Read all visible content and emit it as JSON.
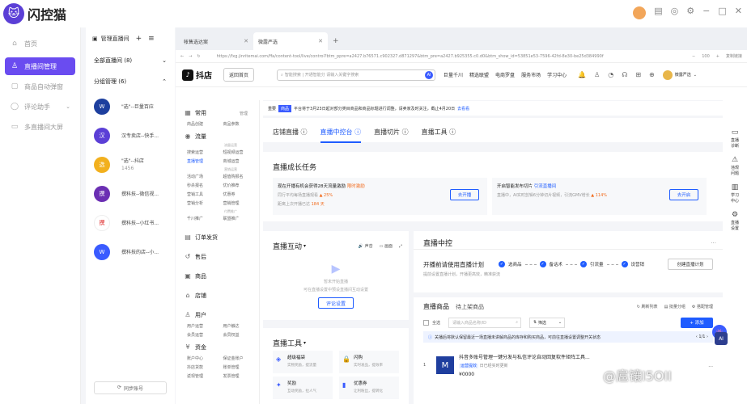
{
  "app": {
    "name": "闪控猫"
  },
  "nav": [
    {
      "label": "首页",
      "icon": "home-icon"
    },
    {
      "label": "直播间管理",
      "icon": "user-icon",
      "active": true
    },
    {
      "label": "商品自动弹窗",
      "icon": "popup-icon"
    },
    {
      "label": "评论助手",
      "icon": "comment-icon",
      "chevron": "⌄"
    },
    {
      "label": "多直播间大屏",
      "icon": "screen-icon"
    }
  ],
  "rooms": {
    "manage_label": "管理直播间",
    "all_rooms": "全部直播间 (8)",
    "grouped": "分组管理 (6)",
    "items": [
      {
        "name": "\"选\"--巨量百应",
        "sub": "",
        "color": "#1d3f9e",
        "glyph": "W"
      },
      {
        "name": "汉专卖店--快手...",
        "sub": "",
        "color": "#5b3fd6",
        "glyph": "汉"
      },
      {
        "name": "\"选\"--抖店",
        "sub": "1456",
        "color": "#f2b01e",
        "glyph": "选"
      },
      {
        "name": "撰科技--微信视...",
        "sub": "",
        "color": "#6b2fb3",
        "glyph": "撰"
      },
      {
        "name": "撰科技--小红书...",
        "sub": "",
        "color": "#ffffff",
        "glyph": "撰"
      },
      {
        "name": "撰科技的店--小...",
        "sub": "",
        "color": "#3a5bff",
        "glyph": "W"
      }
    ],
    "sync_button": "同步账号"
  },
  "browser": {
    "tabs": [
      {
        "label": "帐售选达案"
      },
      {
        "label": "微露严选"
      }
    ],
    "url": "https://fxg.jinritemai.com/ffa/content-tool/live/control?btm_ppre=a2427.b76571.c902327.d871297&btm_pre=a2427.b925355.c0.d0&btm_show_id=53851e53-7596-42fd-8e30-be25d384990f",
    "zoom": "100",
    "zoom_suffix": "+",
    "print_label": "复制链接"
  },
  "douyin": {
    "logo": "抖店",
    "back_home": "返回首页",
    "search_placeholder": "智能搜索 | 开通智能分 请输入关键字搜索",
    "ai_badge": "AI",
    "links": [
      "巨量千川",
      "精选联盟",
      "电商罗盘",
      "服务市场",
      "学习中心"
    ],
    "shop_name": "微露严选"
  },
  "side": {
    "groups": [
      {
        "icon": "grid-icon",
        "label": "常用",
        "right": "管理",
        "caption": "",
        "items": [
          "商品创建",
          "商品参数"
        ],
        "active": -1
      },
      {
        "icon": "flame-icon",
        "label": "流量",
        "right": "",
        "caption": "流量运营",
        "items": [
          "搜索运营",
          "短视频运营",
          "直播管理",
          "商城运营"
        ],
        "active": 2
      },
      {
        "icon": "",
        "label": "",
        "right": "",
        "caption": "营销运营",
        "items": [
          "活动广场",
          "超值购报名",
          "秒杀报名",
          "优价推荐",
          "营销工具",
          "优惠券",
          "营销分析",
          "营销管理"
        ],
        "active": -1
      },
      {
        "icon": "",
        "label": "",
        "right": "",
        "caption": "付费推广",
        "items": [
          "千川推广",
          "联盟推广"
        ],
        "active": -1
      },
      {
        "icon": "order-icon",
        "label": "订单发货",
        "right": "",
        "caption": "",
        "items": [],
        "active": -1
      },
      {
        "icon": "after-sale-icon",
        "label": "售后",
        "right": "",
        "caption": "",
        "items": [],
        "active": -1
      },
      {
        "icon": "box-icon",
        "label": "商品",
        "right": "",
        "caption": "",
        "items": [],
        "active": -1
      },
      {
        "icon": "store-icon",
        "label": "店铺",
        "right": "",
        "caption": "",
        "items": [],
        "active": -1
      },
      {
        "icon": "users-icon",
        "label": "用户",
        "right": "",
        "caption": "",
        "items": [
          "用户运营",
          "用户触达",
          "会员运营",
          "会员权益"
        ],
        "active": -1
      },
      {
        "icon": "money-icon",
        "label": "资金",
        "right": "",
        "caption": "",
        "items": [
          "账户中心",
          "保证金账户",
          "抖店货款",
          "账单管理",
          "返现管理",
          "发票管理"
        ],
        "active": -1
      }
    ]
  },
  "notice": {
    "tag_label": "重要",
    "tag": "商品",
    "text": "平台将于3月23日起对部分类目商品和商品标题进行调整，请卖家及时关注，截止4月20日",
    "link": "去看看"
  },
  "subtabs": [
    "店铺直播 ⓘ",
    "直播中控台 ⓘ",
    "直播切片 ⓘ",
    "直播工具 ⓘ"
  ],
  "growth": {
    "title": "直播成长任务",
    "task1": {
      "title": "现在开播有机会获得28天流量激励",
      "hot": "限时激励",
      "desc": "同行平均每场直播观看",
      "rate": "▲ 25%",
      "desc2": "距离上次开播已达",
      "days": "184 天",
      "button": "去开播"
    },
    "task2": {
      "title": "开启智能发布切片",
      "link": "引流直播间",
      "desc": "直播中，AI实时剪辑6分钟切片视频，引流GMV增长",
      "rate": "▲ 114%",
      "button": "去开启"
    }
  },
  "interaction": {
    "title": "直播互动",
    "sound": "声音",
    "image": "画面",
    "empty_1": "暂未开始直播",
    "empty_2": "可在直播设置中预设直播间互动设置",
    "button": "评论设置"
  },
  "tools": {
    "title": "直播工具",
    "items": [
      {
        "icon": "bag-icon",
        "name": "超级福袋",
        "desc": "实物奖励，提流量"
      },
      {
        "icon": "lock-icon",
        "name": "闪购",
        "desc": "实时发品，提效率"
      },
      {
        "icon": "gift-icon",
        "name": "奖励",
        "desc": "互动奖励，拉人气"
      },
      {
        "icon": "coupon-icon",
        "name": "优惠券",
        "desc": "让利粉丝，提转化"
      }
    ]
  },
  "control": {
    "title": "直播中控",
    "pre_title": "开播前请使用直播计划",
    "pre_desc": "提前设置直播计划，开播更高效，精准获流",
    "steps": [
      "选商品",
      "备话术",
      "引流量",
      "设营销"
    ],
    "plan_button": "创建直播计划",
    "goods_title": "直播商品",
    "goods_tab": "待上架商品",
    "goods_actions": [
      "刷新列表",
      "批量分组",
      "搭配管理"
    ],
    "select_all": "全选",
    "search_placeholder": "请输入商品名称/ID",
    "filter": "筛选",
    "add_button": "+ 添加",
    "info": "关播后将默认保留最近一场直播未讲解商品的库存和购买商品，可前往直播设置调整开关状态",
    "pager": "1/1",
    "product": {
      "index": "1",
      "title": "抖音多账号管理一键分发与私信评论自动回复软件矩阵工具...",
      "tag": "运营提效",
      "tag2": "日已经实时更新",
      "price": "¥0000",
      "tail": "..."
    }
  },
  "rightrail": [
    {
      "icon": "screen-icon",
      "label": "直播\n诊断"
    },
    {
      "icon": "warning-icon",
      "label": "违规\n问题"
    },
    {
      "icon": "book-icon",
      "label": "学习\n中心"
    },
    {
      "icon": "gear-icon",
      "label": "直播\n设置"
    }
  ],
  "watermark": "@扈镶I5OII"
}
